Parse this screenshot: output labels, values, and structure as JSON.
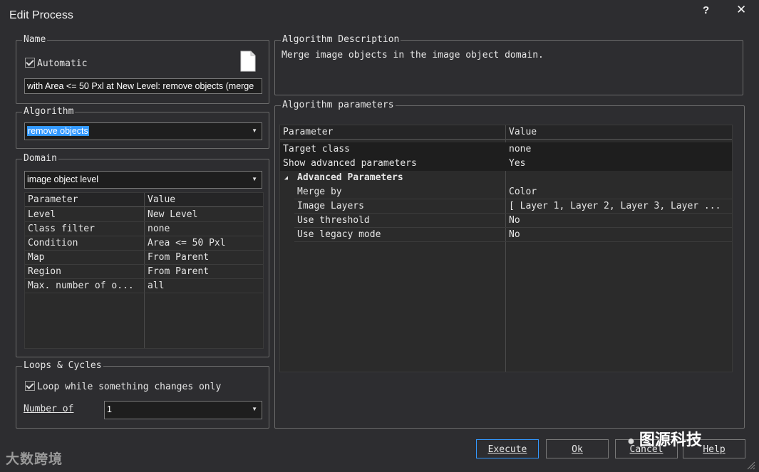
{
  "window": {
    "title": "Edit Process",
    "help_label": "?",
    "close_label": "✕"
  },
  "name_group": {
    "legend": "Name",
    "automatic_label": "Automatic",
    "automatic_checked": true,
    "name_value": "with Area <= 50 Pxl at  New Level: remove objects (merge"
  },
  "algorithm_group": {
    "legend": "Algorithm",
    "selected": "remove objects"
  },
  "domain_group": {
    "legend": "Domain",
    "selected": "image object level",
    "columns": [
      "Parameter",
      "Value"
    ],
    "rows": [
      {
        "param": "Level",
        "value": "New Level"
      },
      {
        "param": "Class filter",
        "value": "none"
      },
      {
        "param": "Condition",
        "value": "Area <= 50 Pxl"
      },
      {
        "param": "Map",
        "value": "From Parent"
      },
      {
        "param": "Region",
        "value": "From Parent"
      },
      {
        "param": "Max. number of o...",
        "value": "all"
      }
    ]
  },
  "loops_group": {
    "legend": "Loops & Cycles",
    "loop_label": "Loop while something changes only",
    "loop_checked": true,
    "number_label": "Number of",
    "number_value": "1"
  },
  "description_group": {
    "legend": "Algorithm Description",
    "text": "Merge image objects in the image object domain."
  },
  "parameters_group": {
    "legend": "Algorithm parameters",
    "columns": [
      "Parameter",
      "Value"
    ],
    "rows": [
      {
        "param": "Target class",
        "value": "none"
      },
      {
        "param": "Show advanced parameters",
        "value": "Yes"
      }
    ],
    "advanced_header": "Advanced Parameters",
    "advanced_rows": [
      {
        "param": "Merge by",
        "value": "Color"
      },
      {
        "param": "Image Layers",
        "value": "[ Layer 1, Layer 2, Layer 3, Layer ..."
      },
      {
        "param": "Use threshold",
        "value": "No"
      },
      {
        "param": "Use legacy mode",
        "value": "No"
      }
    ]
  },
  "buttons": {
    "execute": "Execute",
    "ok": "Ok",
    "cancel": "Cancel",
    "help": "Help"
  },
  "watermarks": {
    "left": "大数跨境",
    "right": "图源科技"
  }
}
